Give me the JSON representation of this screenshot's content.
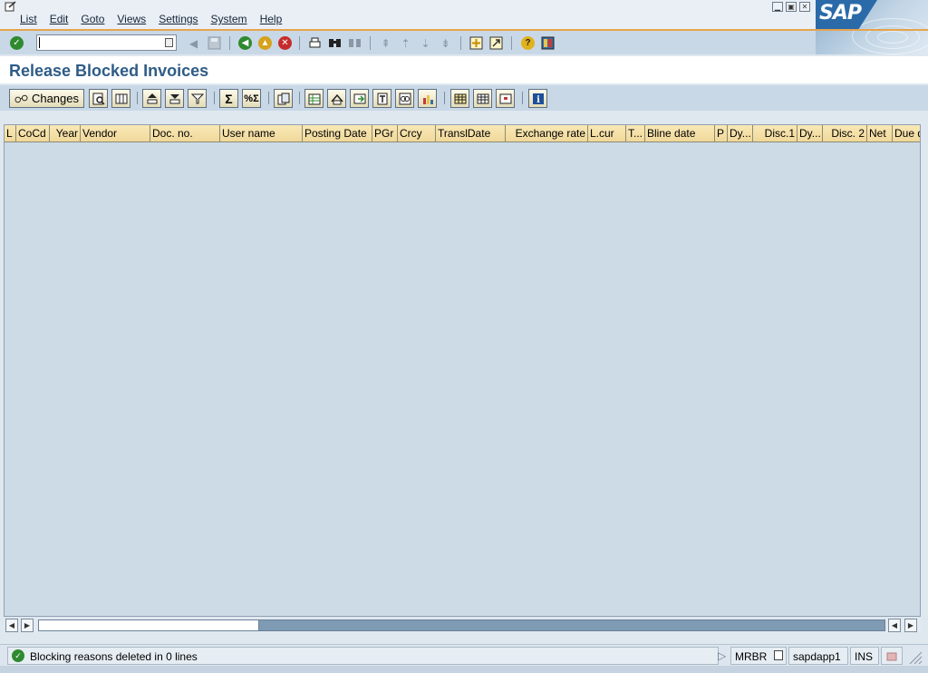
{
  "menu": {
    "items": [
      {
        "label": "List"
      },
      {
        "label": "Edit"
      },
      {
        "label": "Goto"
      },
      {
        "label": "Views"
      },
      {
        "label": "Settings"
      },
      {
        "label": "System"
      },
      {
        "label": "Help"
      }
    ]
  },
  "logo": {
    "text": "SAP"
  },
  "command_field": {
    "value": ""
  },
  "title": "Release Blocked Invoices",
  "app_toolbar": {
    "changes_label": "Changes"
  },
  "grid": {
    "columns": [
      {
        "label": "L"
      },
      {
        "label": "CoCd"
      },
      {
        "label": "Year"
      },
      {
        "label": "Vendor"
      },
      {
        "label": "Doc. no."
      },
      {
        "label": "User name"
      },
      {
        "label": "Posting Date"
      },
      {
        "label": "PGr"
      },
      {
        "label": "Crcy"
      },
      {
        "label": "TranslDate"
      },
      {
        "label": "Exchange rate"
      },
      {
        "label": "L.cur"
      },
      {
        "label": "T..."
      },
      {
        "label": "Bline date"
      },
      {
        "label": "P"
      },
      {
        "label": "Dy..."
      },
      {
        "label": "Disc.1"
      },
      {
        "label": "Dy..."
      },
      {
        "label": "Disc. 2"
      },
      {
        "label": "Net"
      },
      {
        "label": "Due d"
      }
    ],
    "rows": []
  },
  "status": {
    "message": "Blocking reasons deleted in 0 lines",
    "transaction": "MRBR",
    "server": "sapdapp1",
    "mode": "INS"
  },
  "colors": {
    "title": "#2e5c86",
    "toolbar_bg": "#c9d8e6",
    "grid_bg": "#cddbe7",
    "header_bg": "#f0d89a",
    "accent_line": "#e7a44c"
  }
}
